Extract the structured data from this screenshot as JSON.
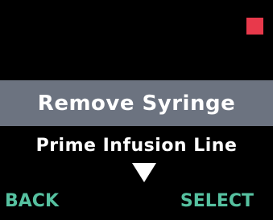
{
  "device": {
    "status_indicator_color": "#e8394b",
    "highlight_color": "#6c7380",
    "softkey_color": "#56c1a0"
  },
  "menu": {
    "items": [
      {
        "label": "Remove Syringe",
        "selected": true
      },
      {
        "label": "Prime Infusion Line",
        "selected": false
      }
    ],
    "scroll_icon": "triangle-down-icon"
  },
  "softkeys": {
    "left": "BACK",
    "right": "SELECT"
  }
}
